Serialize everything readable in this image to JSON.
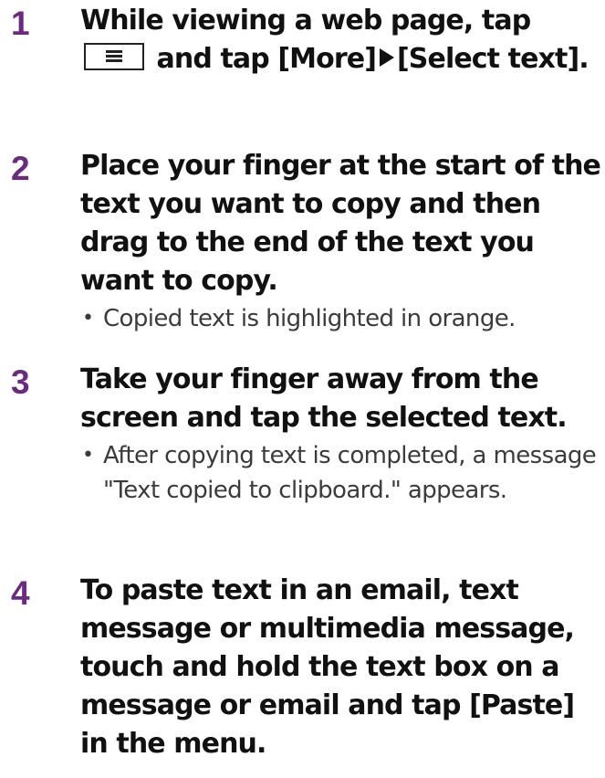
{
  "steps": [
    {
      "number": "1",
      "title_part1": "While viewing a web page, tap",
      "title_part2": "and tap [More]",
      "title_part3": "[Select text].",
      "menu_key_icon": "menu-key-icon",
      "arrow_icon": "right-triangle-icon"
    },
    {
      "number": "2",
      "title": "Place your finger at the start of the text you want to copy and then drag to the end of the text you want to copy.",
      "bullets": [
        "Copied text is highlighted in orange."
      ]
    },
    {
      "number": "3",
      "title": "Take your finger away from the screen and tap the selected text.",
      "bullets": [
        "After copying text is completed, a message \"Text copied to clipboard.\" appears."
      ]
    },
    {
      "number": "4",
      "title": "To paste text in an email, text message or multimedia message, touch and hold the text box on a message or email and tap [Paste] in the menu."
    }
  ],
  "bullet_char": "•",
  "colors": {
    "step_number": "#6a2a7e",
    "title_text": "#111111",
    "bullet_text": "#3b3b3b"
  }
}
